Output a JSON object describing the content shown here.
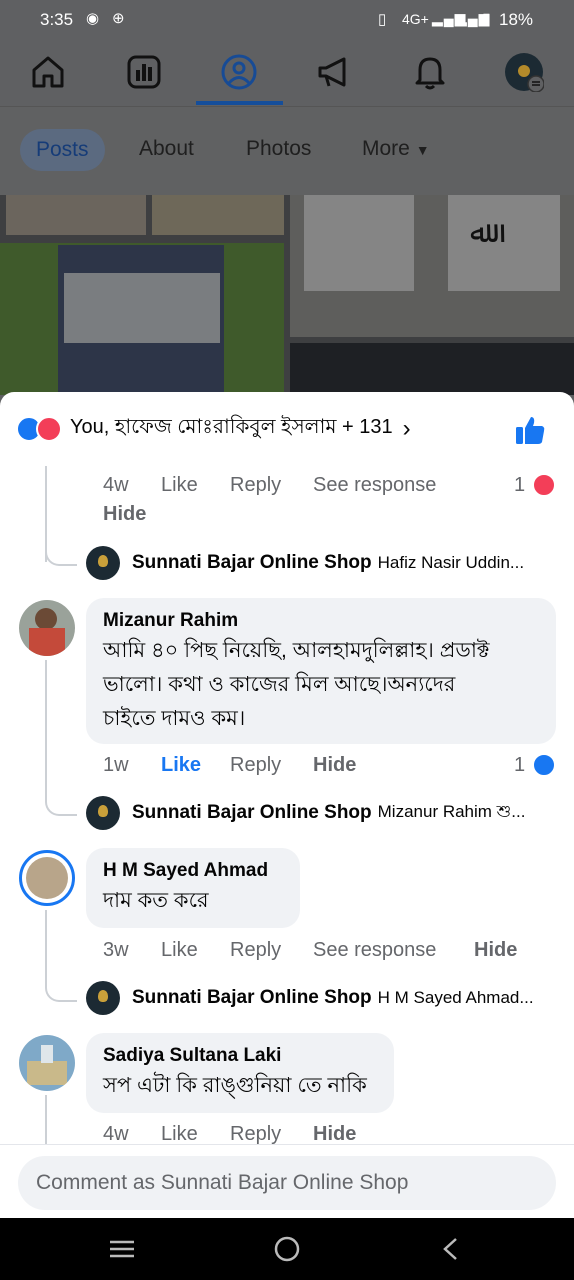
{
  "status": {
    "time": "3:35",
    "network": "4G+",
    "battery": "18%"
  },
  "nav": {
    "items": [
      "home-icon",
      "dashboard-icon",
      "profile-icon",
      "megaphone-icon",
      "bell-icon",
      "page-avatar"
    ]
  },
  "tabs": {
    "posts": "Posts",
    "about": "About",
    "photos": "Photos",
    "more": "More"
  },
  "reactions": {
    "summary": "You, হাফেজ মোঃরাকিবুল ইসলাম + 131"
  },
  "comments": {
    "c0": {
      "time": "4w",
      "like": "Like",
      "reply": "Reply",
      "see_response": "See response",
      "hide": "Hide",
      "count": "1"
    },
    "r0": {
      "name": "Sunnati Bajar Online Shop",
      "text": "Hafiz Nasir Uddin..."
    },
    "c1": {
      "name": "Mizanur Rahim",
      "text1": "আমি ৪০ পিছ নিয়েছি, আলহামদুলিল্লাহ। প্রডাক্ট",
      "text2": "ভালো। কথা ও কাজের মিল আছে।অন্যদের",
      "text3": "চাইতে দামও কম।",
      "time": "1w",
      "like": "Like",
      "reply": "Reply",
      "hide": "Hide",
      "count": "1"
    },
    "r1": {
      "name": "Sunnati Bajar Online Shop",
      "text": "Mizanur Rahim শু..."
    },
    "c2": {
      "name": "H M Sayed Ahmad",
      "text": "দাম কত করে",
      "time": "3w",
      "like": "Like",
      "reply": "Reply",
      "see_response": "See response",
      "hide": "Hide"
    },
    "r2": {
      "name": "Sunnati Bajar Online Shop",
      "text": "H M Sayed Ahmad..."
    },
    "c3": {
      "name": "Sadiya Sultana Laki",
      "text": "সপ এটা কি রাঙ্গুনিয়া তে নাকি",
      "time": "4w",
      "like": "Like",
      "reply": "Reply",
      "hide": "Hide"
    }
  },
  "composer": {
    "placeholder": "Comment as Sunnati Bajar Online Shop"
  },
  "colors": {
    "facebook_blue": "#1877f2",
    "love_red": "#f33e58",
    "text_gray": "#65676b"
  }
}
